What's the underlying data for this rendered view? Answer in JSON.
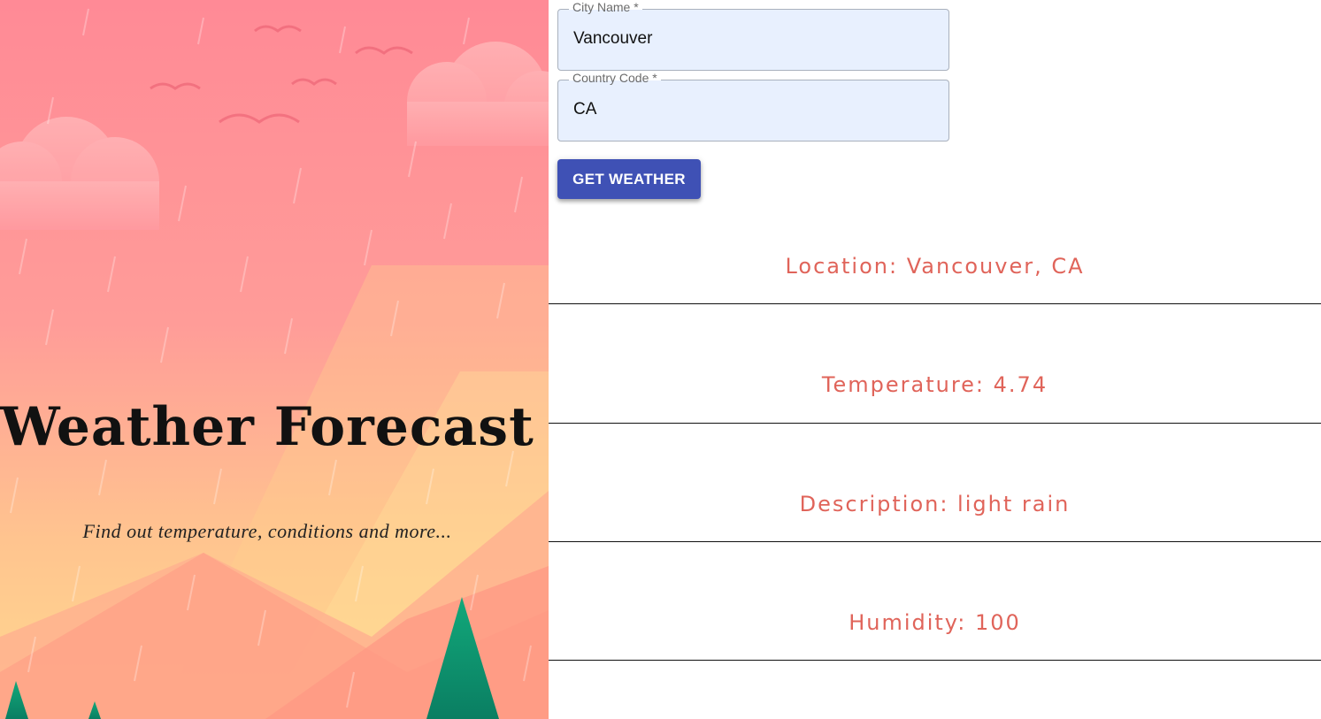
{
  "hero": {
    "title": "Weather Forecast",
    "subtitle": "Find out temperature, conditions and more..."
  },
  "form": {
    "city": {
      "label": "City Name *",
      "value": "Vancouver"
    },
    "country": {
      "label": "Country Code *",
      "value": "CA"
    },
    "submit_label": "GET WEATHER"
  },
  "results": {
    "location": "Location: Vancouver, CA",
    "temperature": "Temperature: 4.74",
    "description": "Description: light rain",
    "humidity": "Humidity: 100"
  },
  "colors": {
    "accent": "#3f51b5",
    "result_text": "#e0645a",
    "field_bg": "#e8f0fe"
  }
}
